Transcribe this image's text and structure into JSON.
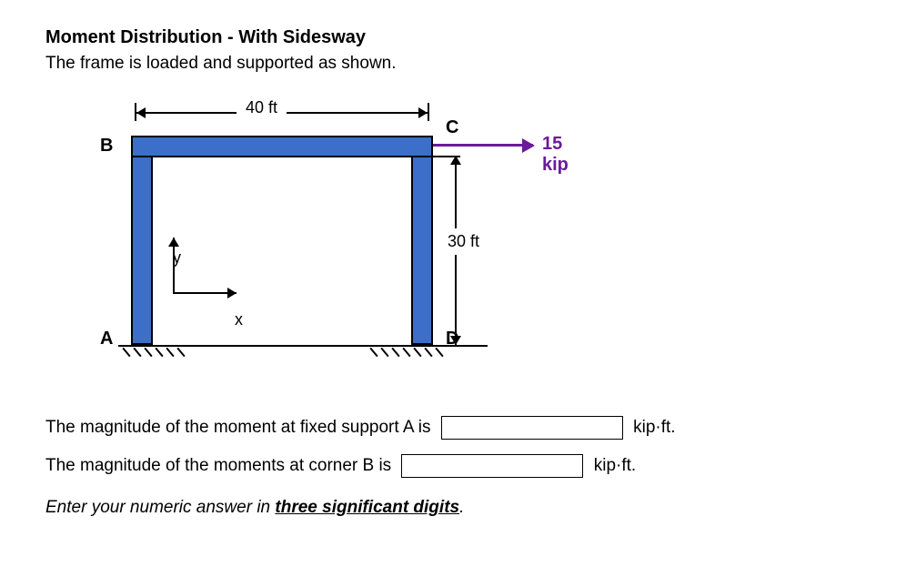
{
  "title": "Moment Distribution - With Sidesway",
  "subtitle": "The frame is loaded and supported as shown.",
  "diagram": {
    "span_label": "40 ft",
    "height_label": "30 ft",
    "load_label": "15 kip",
    "corner_A": "A",
    "corner_B": "B",
    "corner_C": "C",
    "corner_D": "D",
    "axis_x": "x",
    "axis_y": "y"
  },
  "questions": {
    "q1_pre": "The magnitude of the moment at fixed support A is",
    "q1_unit": "kip·ft.",
    "q2_pre": "The magnitude of the moments at corner B is",
    "q2_unit": "kip·ft.",
    "instr_pre": "Enter your numeric answer in ",
    "instr_em": "three significant digits",
    "instr_post": "."
  }
}
